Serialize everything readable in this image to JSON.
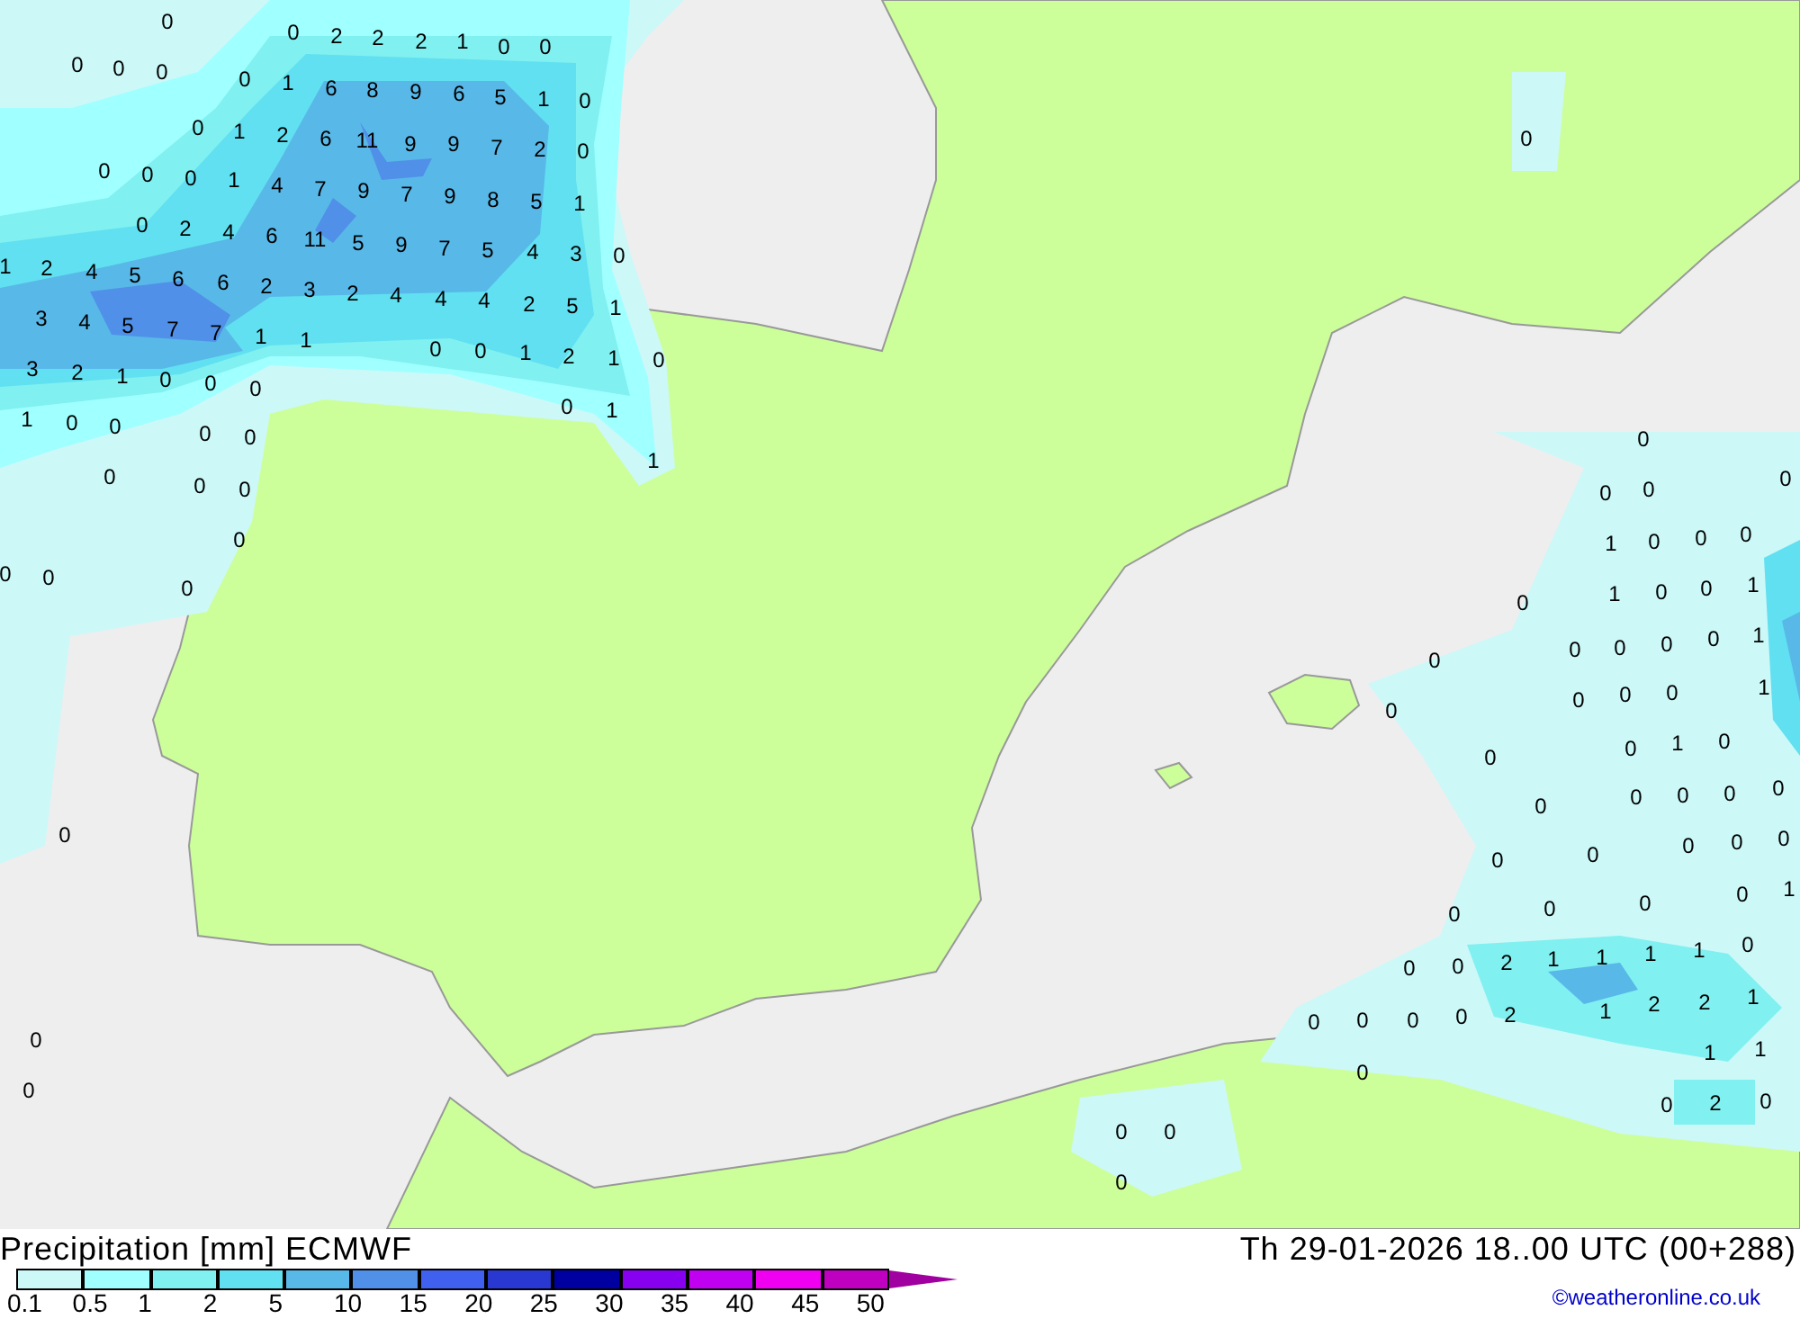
{
  "map": {
    "values": [
      "0",
      "0",
      "2",
      "2",
      "2",
      "1",
      "0",
      "0",
      "0",
      "0",
      "0",
      "0",
      "1",
      "6",
      "8",
      "9",
      "6",
      "5",
      "1",
      "0",
      "0",
      "1",
      "2",
      "6",
      "11",
      "9",
      "9",
      "7",
      "2",
      "0",
      "0",
      "0",
      "0",
      "0",
      "1",
      "4",
      "7",
      "9",
      "7",
      "9",
      "8",
      "5",
      "1",
      "0",
      "2",
      "4",
      "6",
      "11",
      "5",
      "9",
      "7",
      "5",
      "4",
      "3",
      "0",
      "1",
      "2",
      "4",
      "5",
      "6",
      "6",
      "2",
      "3",
      "2",
      "4",
      "4",
      "4",
      "2",
      "5",
      "1",
      "3",
      "4",
      "5",
      "7",
      "7",
      "1",
      "1",
      "0",
      "0",
      "1",
      "2",
      "1",
      "0",
      "3",
      "2",
      "1",
      "0",
      "0",
      "0",
      "0",
      "1",
      "1",
      "0",
      "0",
      "0",
      "0",
      "0",
      "1",
      "0",
      "0",
      "0",
      "0",
      "0",
      "0",
      "0",
      "1",
      "0",
      "0",
      "0",
      "0",
      "0",
      "0",
      "0",
      "1",
      "0",
      "0",
      "1",
      "0",
      "0",
      "0",
      "0",
      "1",
      "0",
      "0",
      "0",
      "0",
      "1",
      "0",
      "0",
      "0",
      "1",
      "0",
      "0",
      "0",
      "0",
      "0",
      "0",
      "0",
      "0",
      "0",
      "0",
      "0",
      "0",
      "0",
      "0",
      "0",
      "0",
      "1",
      "0",
      "0",
      "2",
      "1",
      "1",
      "1",
      "1",
      "0",
      "0",
      "0",
      "0",
      "0",
      "2",
      "1",
      "2",
      "2",
      "1",
      "0",
      "0",
      "1",
      "1",
      "0",
      "0",
      "2",
      "0",
      "0",
      "0",
      "0"
    ]
  },
  "legend": {
    "title": "Precipitation [mm] ECMWF",
    "valid_time": "Th 29-01-2026 18..00 UTC (00+288)",
    "swatches": [
      {
        "color": "#ccf8f8"
      },
      {
        "color": "#a0ffff"
      },
      {
        "color": "#80f0f0"
      },
      {
        "color": "#60e0f0"
      },
      {
        "color": "#58b8e8"
      },
      {
        "color": "#5090e8"
      },
      {
        "color": "#4060f0"
      },
      {
        "color": "#2838d0"
      },
      {
        "color": "#0000a0"
      },
      {
        "color": "#8800f0"
      },
      {
        "color": "#c000f0"
      },
      {
        "color": "#f000f0"
      },
      {
        "color": "#c000c0"
      }
    ],
    "overflow_marks": [
      {
        "kind": "arrow",
        "color": "#a000a0"
      }
    ],
    "labels": [
      "0.1",
      "0.5",
      "1",
      "2",
      "5",
      "10",
      "15",
      "20",
      "25",
      "30",
      "35",
      "40",
      "45",
      "50"
    ],
    "credit": "©weatheronline.co.uk"
  }
}
